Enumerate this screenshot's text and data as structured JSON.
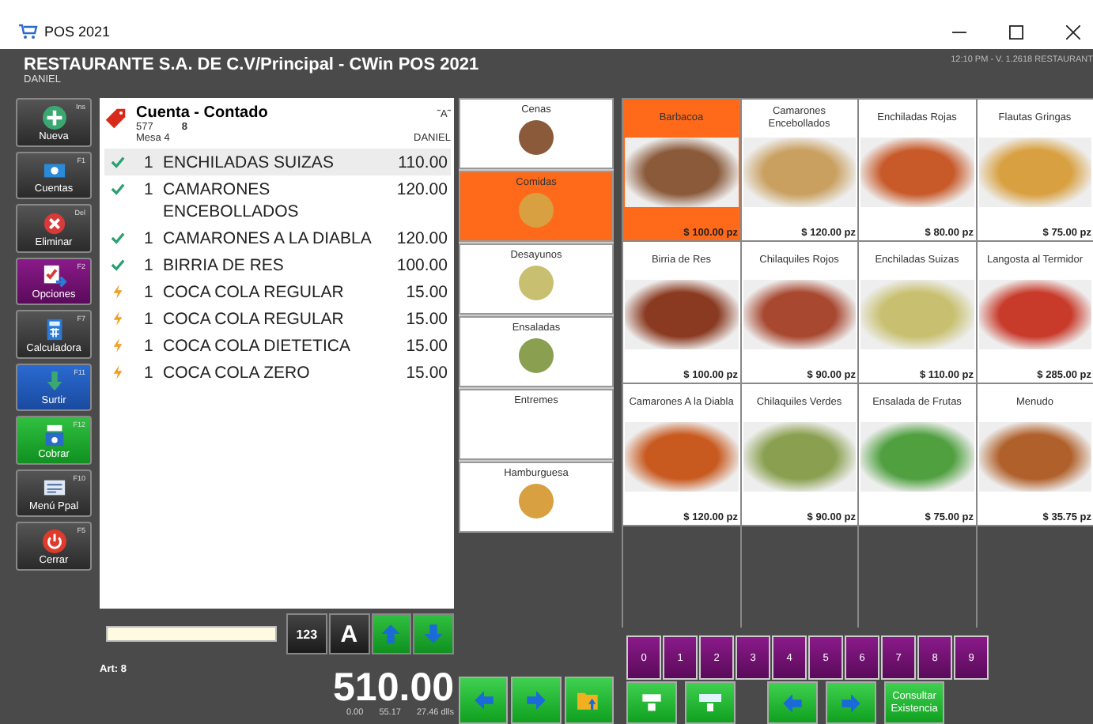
{
  "window": {
    "title": "POS 2021"
  },
  "header": {
    "title": "RESTAURANTE S.A. DE C.V/Principal - CWin POS 2021",
    "user": "DANIEL",
    "info": "12:10 PM - V. 1.2618 RESTAURANT"
  },
  "toolbar": [
    {
      "label": "Nueva",
      "key": "Ins",
      "kind": "dark"
    },
    {
      "label": "Cuentas",
      "key": "F1",
      "kind": "dark"
    },
    {
      "label": "Eliminar",
      "key": "Del",
      "kind": "dark"
    },
    {
      "label": "Opciones",
      "key": "F2",
      "kind": "purple"
    },
    {
      "label": "Calculadora",
      "key": "F7",
      "kind": "dark"
    },
    {
      "label": "Surtir",
      "key": "F11",
      "kind": "blue"
    },
    {
      "label": "Cobrar",
      "key": "F12",
      "kind": "green"
    },
    {
      "label": "Menú Ppal",
      "key": "F10",
      "kind": "dark"
    },
    {
      "label": "Cerrar",
      "key": "F5",
      "kind": "dark"
    }
  ],
  "ticket": {
    "title": "Cuenta - Contado",
    "folio": "577",
    "count": "8",
    "table": "Mesa 4",
    "tag": "˜A˜",
    "waiter": "DANIEL",
    "items": [
      {
        "kind": "sent",
        "qty": "1",
        "name": "ENCHILADAS SUIZAS",
        "price": "110.00",
        "selected": true
      },
      {
        "kind": "sent",
        "qty": "1",
        "name": "CAMARONES ENCEBOLLADOS",
        "price": "120.00",
        "selected": false
      },
      {
        "kind": "sent",
        "qty": "1",
        "name": "CAMARONES A LA DIABLA",
        "price": "120.00",
        "selected": false
      },
      {
        "kind": "sent",
        "qty": "1",
        "name": "BIRRIA DE RES",
        "price": "100.00",
        "selected": false
      },
      {
        "kind": "pending",
        "qty": "1",
        "name": "COCA COLA REGULAR",
        "price": "15.00",
        "selected": false
      },
      {
        "kind": "pending",
        "qty": "1",
        "name": "COCA COLA REGULAR",
        "price": "15.00",
        "selected": false
      },
      {
        "kind": "pending",
        "qty": "1",
        "name": "COCA COLA DIETETICA",
        "price": "15.00",
        "selected": false
      },
      {
        "kind": "pending",
        "qty": "1",
        "name": "COCA COLA ZERO",
        "price": "15.00",
        "selected": false
      }
    ]
  },
  "entry": {
    "keys": [
      "123",
      "A"
    ]
  },
  "articles": "Art: 8",
  "total": {
    "amount": "510.00",
    "sub": [
      "0.00",
      "55.17",
      "27.46 dlls"
    ]
  },
  "categories": [
    {
      "label": "Cenas",
      "selected": false,
      "image": true
    },
    {
      "label": "Comidas",
      "selected": true,
      "image": true
    },
    {
      "label": "Desayunos",
      "selected": false,
      "image": true
    },
    {
      "label": "Ensaladas",
      "selected": false,
      "image": true
    },
    {
      "label": "Entremes",
      "selected": false,
      "image": false
    },
    {
      "label": "Hamburguesa",
      "selected": false,
      "image": true
    }
  ],
  "products": [
    {
      "name": "Barbacoa",
      "price": "$ 100.00 pz",
      "selected": true
    },
    {
      "name": "Camarones Encebollados",
      "price": "$ 120.00 pz",
      "selected": false
    },
    {
      "name": "Enchiladas Rojas",
      "price": "$ 80.00 pz",
      "selected": false
    },
    {
      "name": "Flautas Gringas",
      "price": "$ 75.00 pz",
      "selected": false
    },
    {
      "name": "Birria de Res",
      "price": "$ 100.00 pz",
      "selected": false
    },
    {
      "name": "Chilaquiles Rojos",
      "price": "$ 90.00 pz",
      "selected": false
    },
    {
      "name": "Enchiladas Suizas",
      "price": "$ 110.00 pz",
      "selected": false
    },
    {
      "name": "Langosta al Termidor",
      "price": "$ 285.00 pz",
      "selected": false
    },
    {
      "name": "Camarones A la Diabla",
      "price": "$ 120.00 pz",
      "selected": false
    },
    {
      "name": "Chilaquiles Verdes",
      "price": "$ 90.00 pz",
      "selected": false
    },
    {
      "name": "Ensalada de Frutas",
      "price": "$ 75.00 pz",
      "selected": false
    },
    {
      "name": "Menudo",
      "price": "$ 35.75 pz",
      "selected": false
    }
  ],
  "keypad": [
    "0",
    "1",
    "2",
    "3",
    "4",
    "5",
    "6",
    "7",
    "8",
    "9"
  ],
  "stock_button": "Consultar Existencia"
}
